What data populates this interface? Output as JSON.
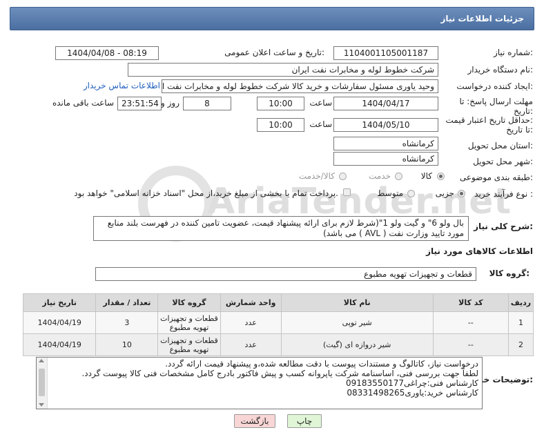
{
  "header": {
    "title": "جزئیات اطلاعات نیاز"
  },
  "need_number": {
    "label": "شماره نیاز:",
    "value": "1104001105001187"
  },
  "announce": {
    "label": "تاریخ و ساعت اعلان عمومی:",
    "value": "1404/04/08 - 08:19"
  },
  "buyer": {
    "label": "نام دستگاه خریدار:",
    "value": "شرکت خطوط لوله و مخابرات نفت ایران"
  },
  "creator": {
    "label": "ایجاد کننده درخواست:",
    "value": "وحید یاوری مسئول سفارشات و خرید کالا  شرکت خطوط لوله و مخابرات نفت ایران",
    "contact_link": "اطلاعات تماس خریدار"
  },
  "deadline": {
    "label1": "مهلت ارسال پاسخ: تا",
    "label2": "تاریخ:",
    "date": "1404/04/17",
    "time_label": "ساعت",
    "time": "10:00",
    "days": "8",
    "days_label": "روز و",
    "remaining": "23:51:54",
    "remaining_label": "ساعت باقی مانده"
  },
  "validity": {
    "label1": "حداقل تاریخ اعتبار قیمت:",
    "label2": "تا تاریخ:",
    "date": "1404/05/10",
    "time_label": "ساعت",
    "time": "10:00"
  },
  "province": {
    "label": "استان محل تحویل:",
    "value": "کرمانشاه"
  },
  "city": {
    "label": "شهر محل تحویل:",
    "value": "کرمانشاه"
  },
  "category": {
    "label": "طبقه بندی موضوعی:",
    "options": [
      "کالا",
      "خدمت",
      "کالا/خدمت"
    ]
  },
  "process": {
    "label": "نوع فرآیند خرید :",
    "options": [
      "جزیی",
      "متوسط"
    ],
    "payment_note": "پرداخت تمام یا بخشی از مبلغ خرید،از محل \"اسناد خزانه اسلامی\" خواهد بود."
  },
  "description": {
    "label": "شرح کلی نیاز:",
    "text": "بال ولو 6\" و گیت ولو 1\"(شرط لازم برای ارائه پیشنهاد قیمت، عضویت تامین کننده در فهرست بلند منابع مورد تایید وزارت نفت ( AVL ) می باشد)"
  },
  "goods_info": {
    "title": "اطلاعات کالاهای مورد نیاز"
  },
  "goods_group": {
    "label": "گروه کالا:",
    "value": "قطعات و تجهیزات تهویه مطبوع"
  },
  "table": {
    "headers": [
      "ردیف",
      "کد کالا",
      "نام کالا",
      "واحد شمارش",
      "گروه کالا",
      "تعداد / مقدار",
      "تاریخ نیاز"
    ],
    "rows": [
      {
        "idx": "1",
        "code": "--",
        "name": "شیر توپی",
        "unit": "عدد",
        "group": "قطعات و تجهیزات تهویه مطبوع",
        "qty": "3",
        "date": "1404/04/19"
      },
      {
        "idx": "2",
        "code": "--",
        "name": "شیر دروازه ای (گیت)",
        "unit": "عدد",
        "group": "قطعات و تجهیزات تهویه مطبوع",
        "qty": "10",
        "date": "1404/04/19"
      }
    ]
  },
  "buyer_notes": {
    "label": "توضیحات خریدار:",
    "lines": [
      "درخواست نیاز، کاتالوگ و مستندات پیوست با دقت مطالعه شده،و پیشنهاد قیمت ارائه گردد.",
      "لطفاً جهت بررسی فنی، اساسنامه شرکت یاپروانه کسب و پیش فاکتور بادرج کامل مشخصات فنی کالا پیوست گردد.",
      "کارشناس فنی:چراغی09183550177",
      "کارشناس خرید:یاوری08331498265"
    ]
  },
  "buttons": {
    "print": "چاپ",
    "back": "بازگشت"
  },
  "watermark": {
    "text": "AriaTender.net"
  },
  "colors": {
    "header": "#5a7db0",
    "link": "#1f5fbf",
    "print_btn": "#dff5d5",
    "back_btn": "#f8d6d6"
  }
}
